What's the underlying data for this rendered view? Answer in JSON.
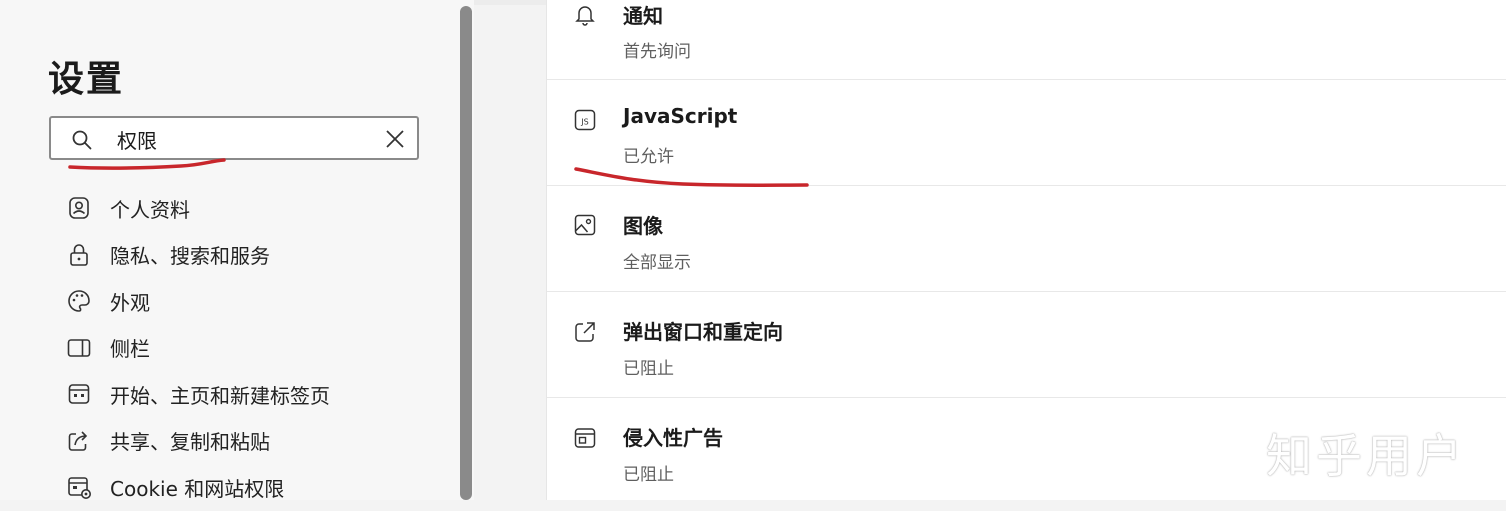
{
  "sidebar": {
    "title": "设置",
    "search": {
      "value": "权限",
      "placeholder": ""
    },
    "items": [
      {
        "label": "个人资料",
        "icon": "profile-icon"
      },
      {
        "label": "隐私、搜索和服务",
        "icon": "lock-icon"
      },
      {
        "label": "外观",
        "icon": "palette-icon"
      },
      {
        "label": "侧栏",
        "icon": "sidebar-icon"
      },
      {
        "label": "开始、主页和新建标签页",
        "icon": "home-tabs-icon"
      },
      {
        "label": "共享、复制和粘贴",
        "icon": "share-icon"
      },
      {
        "label": "Cookie 和网站权限",
        "icon": "cookie-settings-icon"
      }
    ]
  },
  "permissions": [
    {
      "title": "通知",
      "status": "首先询问",
      "icon": "bell-icon"
    },
    {
      "title": "JavaScript",
      "status": "已允许",
      "icon": "javascript-icon"
    },
    {
      "title": "图像",
      "status": "全部显示",
      "icon": "image-icon"
    },
    {
      "title": "弹出窗口和重定向",
      "status": "已阻止",
      "icon": "popup-icon"
    },
    {
      "title": "侵入性广告",
      "status": "已阻止",
      "icon": "ads-icon"
    }
  ],
  "watermark": "知乎用户",
  "colors": {
    "annotation": "#c8262b",
    "panel": "#ffffff",
    "sidebar": "#f7f7f7"
  }
}
